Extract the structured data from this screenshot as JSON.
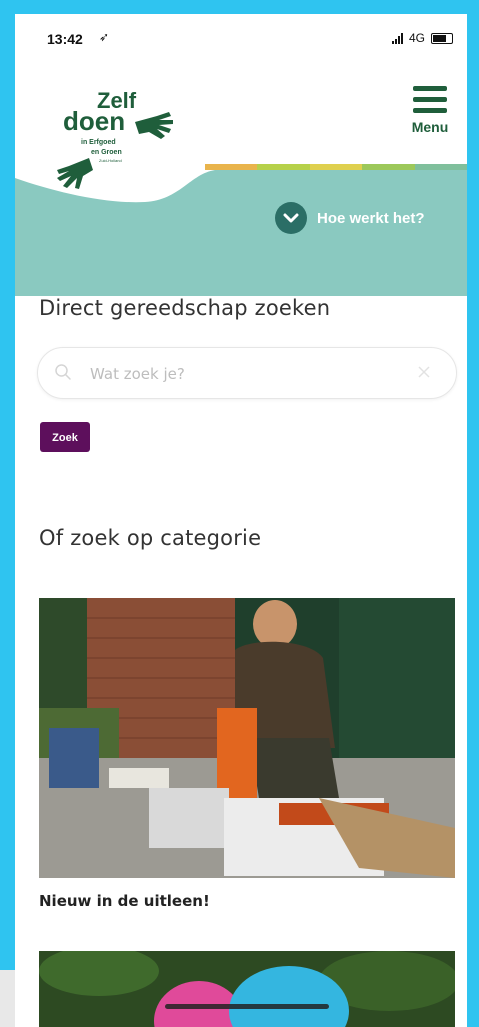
{
  "status": {
    "time": "13:42",
    "network": "4G"
  },
  "header": {
    "logo_text": [
      "Zelf",
      "doen",
      "in Erfgoed",
      "en Groen",
      "Zuid-Holland"
    ],
    "menu_label": "Menu",
    "how_label": "Hoe werkt het?"
  },
  "colors": {
    "teal": "#8ac9c0",
    "dark_green": "#1f5e3b",
    "purple": "#5d0f5c",
    "frame": "#2fc4f0"
  },
  "search": {
    "title": "Direct gereedschap zoeken",
    "placeholder": "Wat zoek je?",
    "button_label": "Zoek"
  },
  "categories": {
    "title": "Of zoek op categorie",
    "cards": [
      {
        "title": "Nieuw in de uitleen!"
      }
    ]
  },
  "icons": {
    "menu": "hamburger-icon",
    "how": "chevron-down-icon",
    "search": "search-icon",
    "clear": "close-icon"
  }
}
